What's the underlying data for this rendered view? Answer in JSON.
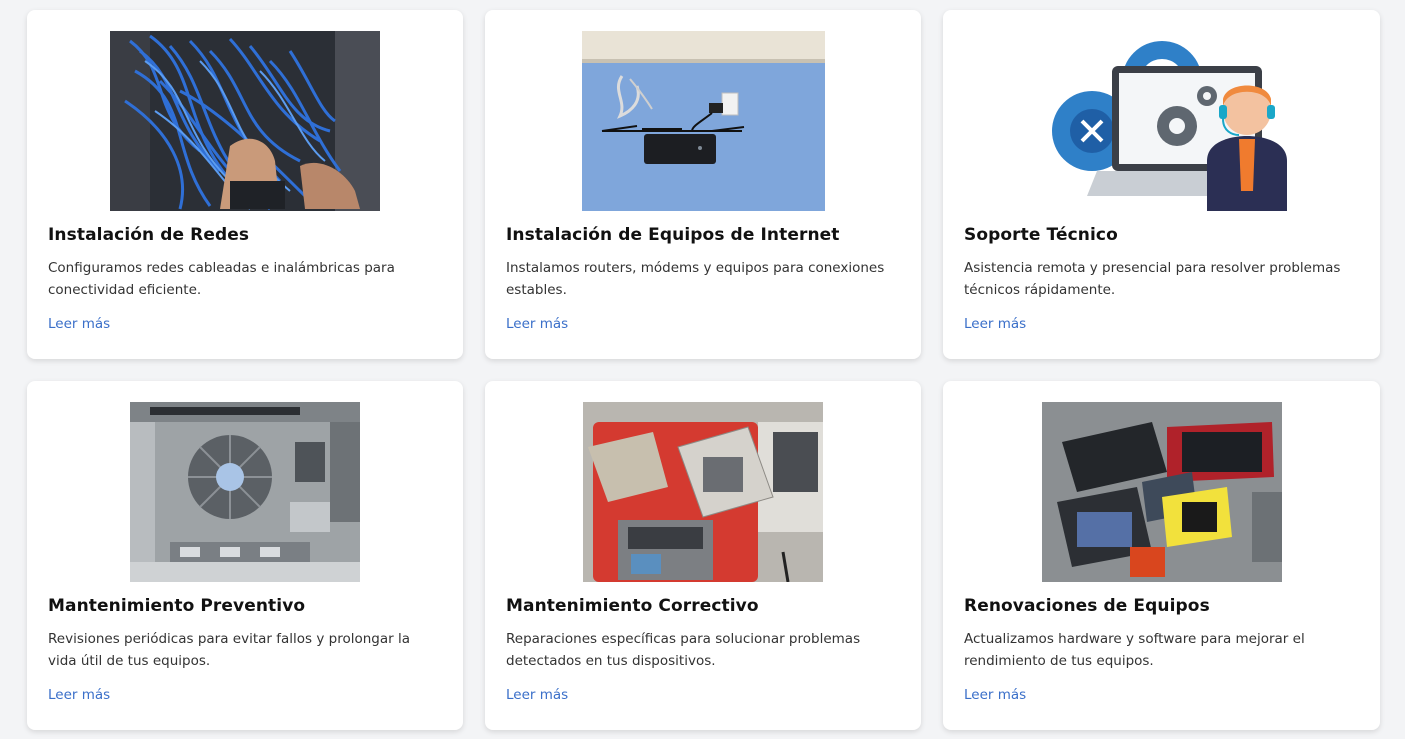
{
  "services": [
    {
      "title": "Instalación de Redes",
      "description": "Configuramos redes cableadas e inalámbricas para conectividad eficiente.",
      "link": "Leer más",
      "image": "network-rack-cables-photo"
    },
    {
      "title": "Instalación de Equipos de Internet",
      "description": "Instalamos routers, módems y equipos para conexiones estables.",
      "link": "Leer más",
      "image": "router-on-wall-photo"
    },
    {
      "title": "Soporte Técnico",
      "description": "Asistencia remota y presencial para resolver problemas técnicos rápidamente.",
      "link": "Leer más",
      "image": "tech-support-illustration"
    },
    {
      "title": "Mantenimiento Preventivo",
      "description": "Revisiones periódicas para evitar fallos y prolongar la vida útil de tus equipos.",
      "link": "Leer más",
      "image": "motherboard-cooler-photo"
    },
    {
      "title": "Mantenimiento Correctivo",
      "description": "Reparaciones específicas para solucionar problemas detectados en tus dispositivos.",
      "link": "Leer más",
      "image": "laptop-repair-mat-photo"
    },
    {
      "title": "Renovaciones de Equipos",
      "description": "Actualizamos hardware y software para mejorar el rendimiento de tus equipos.",
      "link": "Leer más",
      "image": "hardware-boxes-photo"
    }
  ],
  "colors": {
    "background": "#f3f4f6",
    "card": "#ffffff",
    "title": "#111111",
    "text": "#333333",
    "link": "#3a6fc9"
  }
}
